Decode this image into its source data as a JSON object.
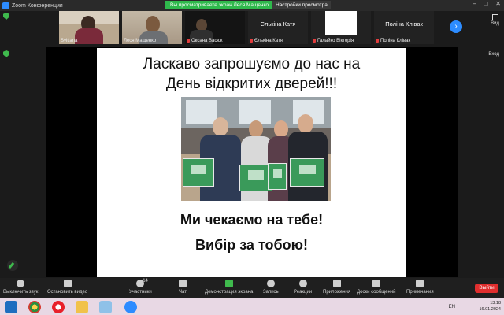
{
  "window": {
    "title": "Zoom Конференция"
  },
  "banner": {
    "sharing": "Вы просматриваете экран Леся Мащенко",
    "view_options": "Настройки просмотра"
  },
  "participants": [
    {
      "name": "Svitlana",
      "muted": false
    },
    {
      "name": "Леся Мащенко",
      "muted": false
    },
    {
      "name": "Оксана Васюк",
      "muted": true
    },
    {
      "name": "Ельkina Катя",
      "big_name": "Єлькіна Катя",
      "muted": true
    },
    {
      "name": "Галайко Вікторія",
      "muted": true
    },
    {
      "name": "Поліна Клівак",
      "big_name": "Поліна Клівак",
      "muted": true
    }
  ],
  "side": {
    "view": "Вид",
    "exit_fullscreen": "Вход"
  },
  "slide": {
    "line1": "Ласкаво запрошуємо до нас на",
    "line2": "День відкритих дверей!!!",
    "line3": "Ми чекаємо на тебе!",
    "line4": "Вибір за тобою!"
  },
  "toolbar": {
    "mute": "Выключить звук",
    "video": "Остановить видео",
    "participants": "Участники",
    "participants_count": "14",
    "chat": "Чат",
    "share": "Демонстрация экрана",
    "record": "Запись",
    "reactions": "Реакции",
    "apps": "Приложения",
    "whiteboards": "Доски сообщений",
    "notes": "Примечания",
    "leave": "Выйти"
  },
  "taskbar": {
    "lang": "EN",
    "time": "13:18",
    "date": "16.01.2024"
  },
  "colors": {
    "accent": "#2d8cff",
    "share_green": "#2fb94c",
    "leave_red": "#e02e2e"
  }
}
